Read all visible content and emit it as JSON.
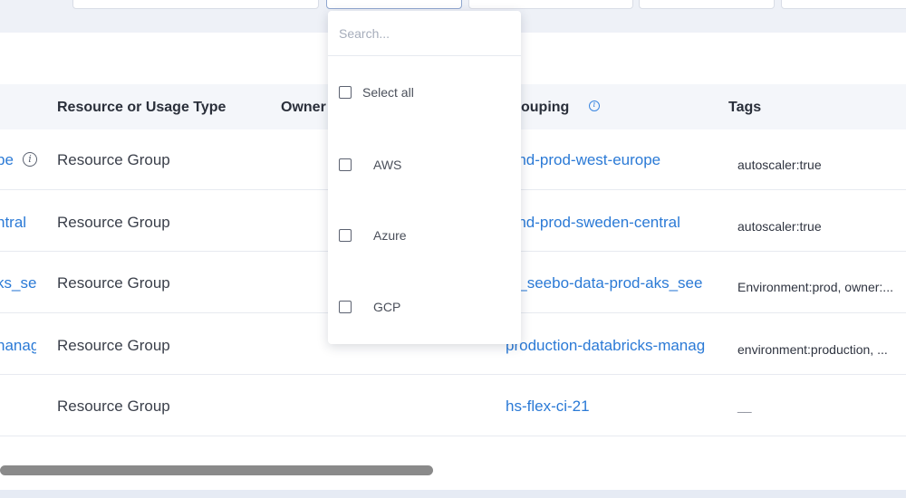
{
  "table": {
    "headers": {
      "resource_type": "Resource or Usage Type",
      "owner": "Owner",
      "grouping": "ouping",
      "tags": "Tags"
    },
    "rows": [
      {
        "name_fragment": "pe",
        "type": "Resource Group",
        "grouping": "-rnd-prod-west-europe",
        "tags": "autoscaler:true"
      },
      {
        "name_fragment": "ntral",
        "type": "Resource Group",
        "grouping": "-rnd-prod-sweden-central",
        "tags": "autoscaler:true"
      },
      {
        "name_fragment": "ks_see",
        "type": "Resource Group",
        "grouping": "C_seebo-data-prod-aks_see",
        "tags": "Environment:prod, owner:..."
      },
      {
        "name_fragment": "nanag",
        "type": "Resource Group",
        "grouping": "production-databricks-manag",
        "tags": "environment:production, ..."
      },
      {
        "name_fragment": "",
        "type": "Resource Group",
        "grouping": "hs-flex-ci-21",
        "tags": "__"
      }
    ]
  },
  "dropdown": {
    "search_placeholder": "Search...",
    "select_all": "Select all",
    "options": [
      "AWS",
      "Azure",
      "GCP"
    ]
  },
  "colors": {
    "link": "#2b7ad6",
    "header_bg": "#f4f6fa",
    "top_band": "#eef1f7"
  }
}
